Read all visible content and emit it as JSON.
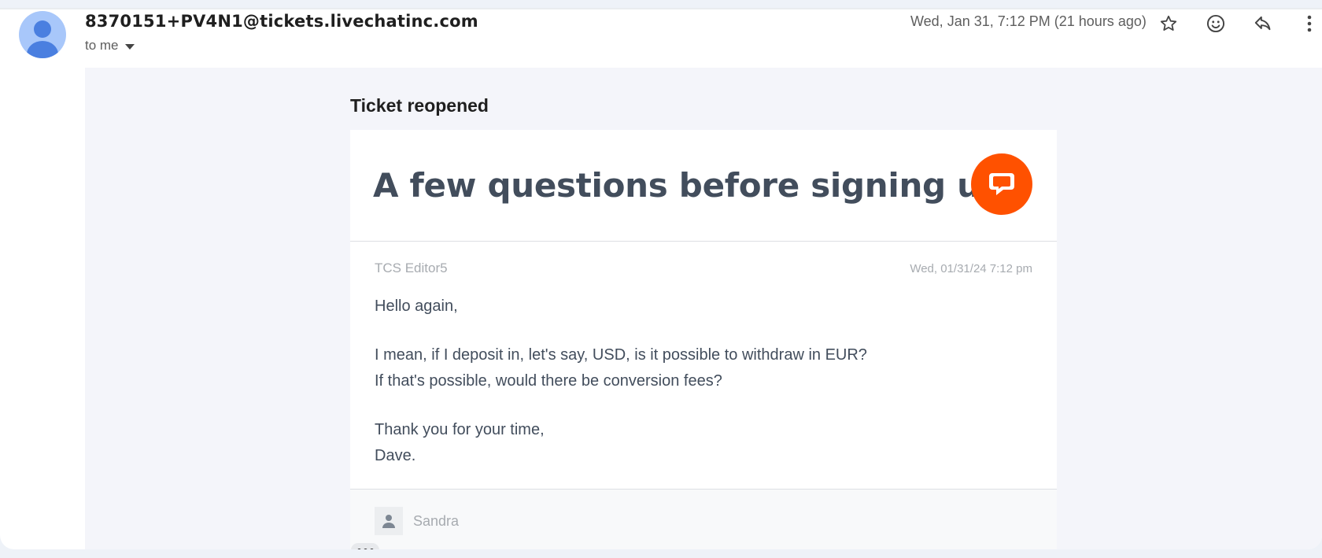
{
  "header": {
    "sender": "8370151+PV4N1@tickets.livechatinc.com",
    "recipient_label": "to me",
    "date": "Wed, Jan 31, 7:12 PM (21 hours ago)",
    "icons": [
      "star-icon",
      "emoji-icon",
      "reply-icon",
      "more-vert-icon"
    ]
  },
  "email": {
    "status_heading": "Ticket reopened",
    "title": "A few questions before signing up.",
    "brand_color": "#ff5100",
    "message": {
      "author": "TCS Editor5",
      "timestamp": "Wed, 01/31/24 7:12 pm",
      "lines": [
        "Hello again,",
        "I mean, if I deposit in, let's say, USD, is it possible to withdraw in EUR?",
        "If that's possible, would there be conversion fees?",
        "Thank you for your time,",
        "Dave."
      ]
    },
    "next_author": "Sandra"
  }
}
